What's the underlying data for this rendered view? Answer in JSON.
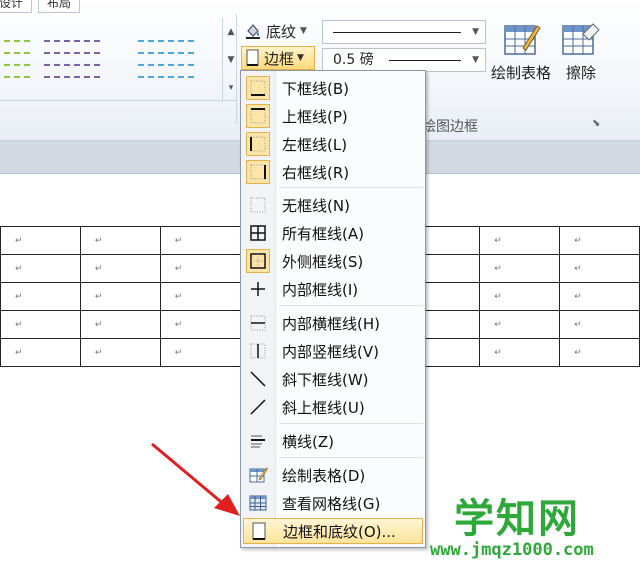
{
  "ribbon": {
    "tabs": [
      "设计",
      "布局"
    ],
    "shading_label": "底纹",
    "borders_label": "边框",
    "line_weight": "0.5 磅",
    "draw_table_label": "绘制表格",
    "eraser_label": "擦除",
    "group_label": "绘图边框",
    "swatch_colors": [
      "#8fc63f",
      "#7b62a8",
      "#4ea7d8"
    ]
  },
  "borders_menu": {
    "items": [
      {
        "label": "下框线(B)",
        "icon": "border-bottom-icon",
        "checked": true
      },
      {
        "label": "上框线(P)",
        "icon": "border-top-icon",
        "checked": true
      },
      {
        "label": "左框线(L)",
        "icon": "border-left-icon",
        "checked": true
      },
      {
        "label": "右框线(R)",
        "icon": "border-right-icon",
        "checked": true
      },
      {
        "label": "无框线(N)",
        "icon": "border-none-icon",
        "checked": false
      },
      {
        "label": "所有框线(A)",
        "icon": "border-all-icon",
        "checked": false
      },
      {
        "label": "外侧框线(S)",
        "icon": "border-outside-icon",
        "checked": true
      },
      {
        "label": "内部框线(I)",
        "icon": "border-inside-icon",
        "checked": false
      },
      {
        "label": "内部横框线(H)",
        "icon": "border-inside-horizontal-icon",
        "checked": false
      },
      {
        "label": "内部竖框线(V)",
        "icon": "border-inside-vertical-icon",
        "checked": false
      },
      {
        "label": "斜下框线(W)",
        "icon": "diagonal-down-icon",
        "checked": false
      },
      {
        "label": "斜上框线(U)",
        "icon": "diagonal-up-icon",
        "checked": false
      },
      {
        "label": "横线(Z)",
        "icon": "horizontal-line-icon",
        "checked": false
      },
      {
        "label": "绘制表格(D)",
        "icon": "draw-table-icon",
        "checked": false
      },
      {
        "label": "查看网格线(G)",
        "icon": "view-gridlines-icon",
        "checked": false
      },
      {
        "label": "边框和底纹(O)...",
        "icon": "borders-shading-icon",
        "checked": false,
        "highlighted": true
      }
    ]
  },
  "document": {
    "cell_mark": "↵"
  },
  "watermark": {
    "title": "学知网",
    "url": "www.jmqz1000.com"
  }
}
